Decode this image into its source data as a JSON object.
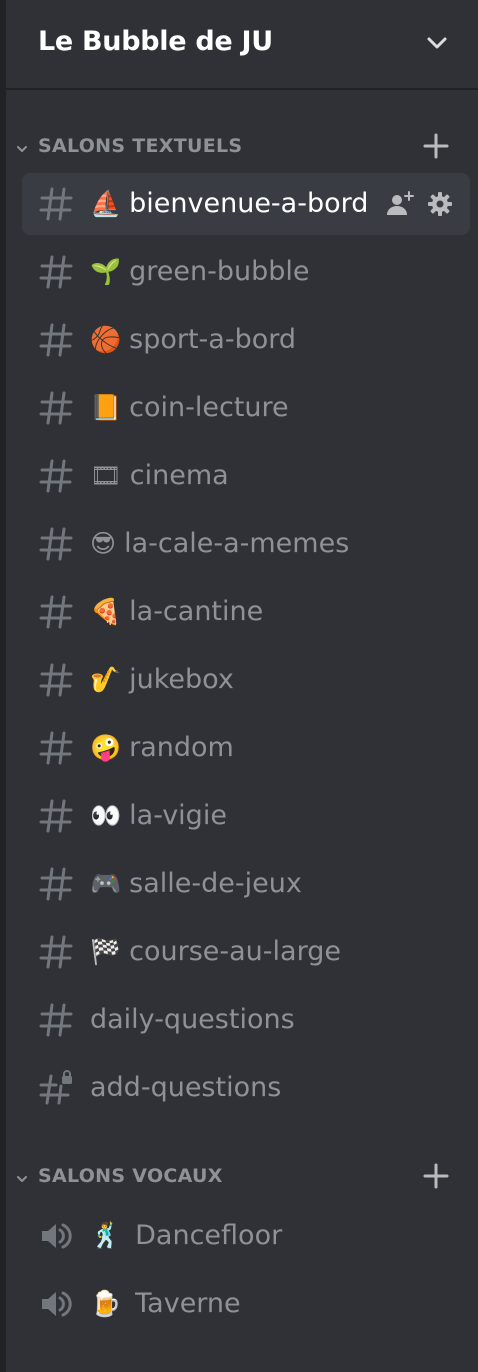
{
  "server": {
    "name": "Le Bubble de JU"
  },
  "categories": [
    {
      "label": "SALONS TEXTUELS",
      "channels": [
        {
          "emoji": "⛵",
          "name": "bienvenue-a-bord",
          "icon": "hash-icon",
          "selected": true
        },
        {
          "emoji": "🌱",
          "name": "green-bubble",
          "icon": "hash-icon"
        },
        {
          "emoji": "🏀",
          "name": "sport-a-bord",
          "icon": "hash-icon"
        },
        {
          "emoji": "📙",
          "name": "coin-lecture",
          "icon": "hash-icon"
        },
        {
          "emoji": "🎞",
          "name": "cinema",
          "icon": "hash-icon"
        },
        {
          "emoji": "😎",
          "name": "la-cale-a-memes",
          "icon": "hash-icon"
        },
        {
          "emoji": "🍕",
          "name": "la-cantine",
          "icon": "hash-icon"
        },
        {
          "emoji": "🎷",
          "name": "jukebox",
          "icon": "hash-icon"
        },
        {
          "emoji": "🤪",
          "name": "random",
          "icon": "hash-icon"
        },
        {
          "emoji": "👀",
          "name": "la-vigie",
          "icon": "hash-icon"
        },
        {
          "emoji": "🎮",
          "name": "salle-de-jeux",
          "icon": "hash-icon"
        },
        {
          "emoji": "🏁",
          "name": "course-au-large",
          "icon": "hash-icon"
        },
        {
          "emoji": "",
          "name": "daily-questions",
          "icon": "hash-icon"
        },
        {
          "emoji": "",
          "name": "add-questions",
          "icon": "locked-hash-icon"
        }
      ]
    },
    {
      "label": "SALONS VOCAUX",
      "channels": [
        {
          "emoji": "🕺",
          "name": "Dancefloor",
          "icon": "speaker-icon"
        },
        {
          "emoji": "🍺",
          "name": "Taverne",
          "icon": "speaker-icon"
        }
      ]
    }
  ],
  "colors": {
    "sidebar_bg": "#2f3136",
    "server_rail": "#202225",
    "selected_bg": "#393c43",
    "text_muted": "#8e9297",
    "text_active": "#ffffff"
  }
}
